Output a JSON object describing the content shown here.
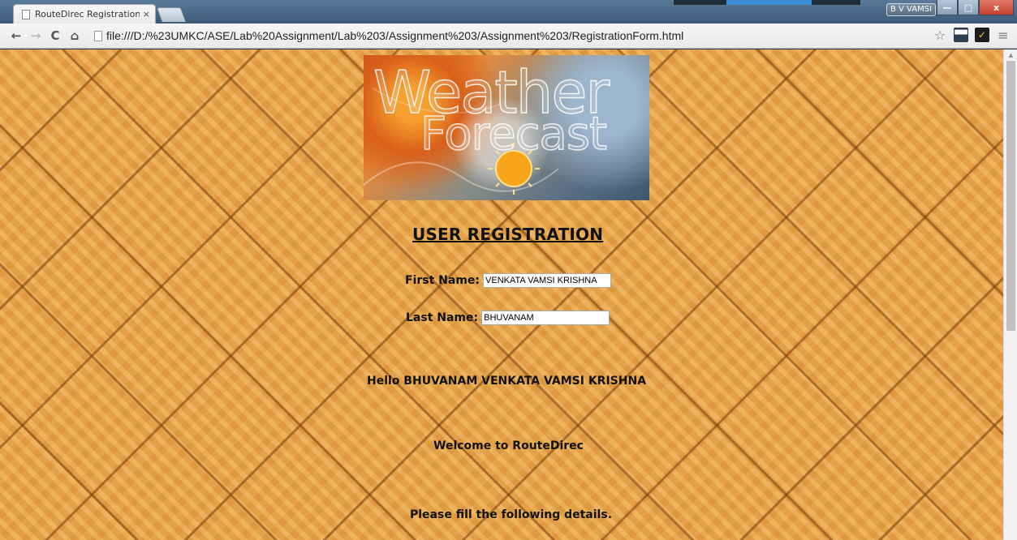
{
  "browser": {
    "tab_title": "RouteDirec Registration F",
    "tab_close": "×",
    "user_badge": "B V VAMSI",
    "url": "file:///D:/%23UMKC/ASE/Lab%20Assignment/Lab%203/Assignment%203/Assignment%203/RegistrationForm.html",
    "nav": {
      "back": "←",
      "forward": "→",
      "reload": "C",
      "home": "⌂"
    },
    "tools": {
      "star": "☆",
      "menu": "≡"
    },
    "window": {
      "minimize": "—",
      "maximize": "□",
      "close": "x"
    }
  },
  "banner": {
    "word1": "Weather",
    "word2": "Forecast"
  },
  "form": {
    "heading": "USER REGISTRATION",
    "first_name_label": "First Name:",
    "first_name_value": "VENKATA VAMSI KRISHNA",
    "last_name_label": "Last Name:",
    "last_name_value": "BHUVANAM"
  },
  "messages": {
    "hello": "Hello BHUVANAM VENKATA VAMSI KRISHNA",
    "welcome": "Welcome to RouteDirec",
    "please": "Please fill the following details."
  },
  "colors": {
    "wood_base": "#e8a74a",
    "wood_seam": "#7a3c0a",
    "text": "#111111",
    "close_button": "#c7402b"
  }
}
